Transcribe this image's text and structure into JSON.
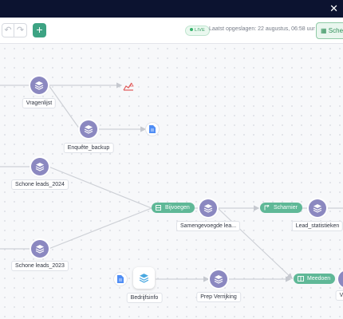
{
  "topbar": {
    "close_icon": "close-icon"
  },
  "toolbar": {
    "undo_icon": "undo-icon",
    "redo_icon": "redo-icon",
    "add_icon": "plus-icon",
    "live_badge": "LIVE",
    "saved_text": "Laatst opgeslagen: 22 augustus, 06:58 uur",
    "schedule_label": "Sche"
  },
  "nodes": {
    "vragenlijst": "Vragenlijst",
    "enquete_backup": "Enquête_backup",
    "schone_leads_2024": "Schone leads_2024",
    "schone_leads_2023": "Schone leads_2023",
    "samengevoegde": "Samengevoegde lea...",
    "lead_statistieken": "Lead_statistieken",
    "bedrijfsinfo": "Bedrijfsinfo",
    "prep_verrijking": "Prep Verrijking",
    "verr": "Verr"
  },
  "actions": {
    "bijvoegen": "Bijvoegen",
    "scharnier": "Scharnier",
    "meedoen": "Meedoen"
  },
  "colors": {
    "node": "#8b88c0",
    "action_pill": "#5fb897",
    "doc_icon": "#4f8df5",
    "warning": "#e05a5a",
    "topbar": "#0c1330"
  }
}
